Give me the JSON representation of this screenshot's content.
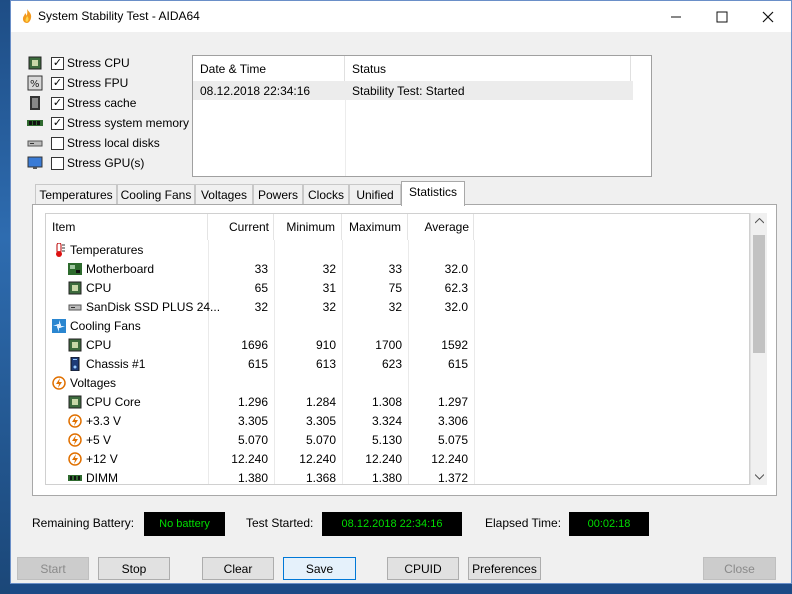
{
  "window": {
    "title": "System Stability Test - AIDA64"
  },
  "stress_options": [
    {
      "label": "Stress CPU",
      "checked": true,
      "icon": "cpu-chip-icon"
    },
    {
      "label": "Stress FPU",
      "checked": true,
      "icon": "fpu-percent-icon"
    },
    {
      "label": "Stress cache",
      "checked": true,
      "icon": "cache-chip-icon"
    },
    {
      "label": "Stress system memory",
      "checked": true,
      "icon": "memory-module-icon"
    },
    {
      "label": "Stress local disks",
      "checked": false,
      "icon": "disk-drive-icon"
    },
    {
      "label": "Stress GPU(s)",
      "checked": false,
      "icon": "monitor-icon"
    }
  ],
  "status_log": {
    "headers": [
      "Date & Time",
      "Status"
    ],
    "rows": [
      {
        "datetime": "08.12.2018 22:34:16",
        "status": "Stability Test: Started"
      }
    ]
  },
  "tabs": [
    "Temperatures",
    "Cooling Fans",
    "Voltages",
    "Powers",
    "Clocks",
    "Unified",
    "Statistics"
  ],
  "active_tab": "Statistics",
  "stats": {
    "headers": {
      "item": "Item",
      "current": "Current",
      "minimum": "Minimum",
      "maximum": "Maximum",
      "average": "Average"
    },
    "rows": [
      {
        "type": "group",
        "label": "Temperatures",
        "icon": "thermometer-icon"
      },
      {
        "type": "item",
        "label": "Motherboard",
        "icon": "motherboard-icon",
        "current": "33",
        "min": "32",
        "max": "33",
        "avg": "32.0"
      },
      {
        "type": "item",
        "label": "CPU",
        "icon": "cpu-chip-icon",
        "current": "65",
        "min": "31",
        "max": "75",
        "avg": "62.3"
      },
      {
        "type": "item",
        "label": "SanDisk SSD PLUS 24...",
        "icon": "disk-drive-icon",
        "current": "32",
        "min": "32",
        "max": "32",
        "avg": "32.0"
      },
      {
        "type": "group",
        "label": "Cooling Fans",
        "icon": "fan-icon"
      },
      {
        "type": "item",
        "label": "CPU",
        "icon": "cpu-chip-icon",
        "current": "1696",
        "min": "910",
        "max": "1700",
        "avg": "1592"
      },
      {
        "type": "item",
        "label": "Chassis #1",
        "icon": "chassis-icon",
        "current": "615",
        "min": "613",
        "max": "623",
        "avg": "615"
      },
      {
        "type": "group",
        "label": "Voltages",
        "icon": "voltage-icon"
      },
      {
        "type": "item",
        "label": "CPU Core",
        "icon": "cpu-chip-icon",
        "current": "1.296",
        "min": "1.284",
        "max": "1.308",
        "avg": "1.297"
      },
      {
        "type": "item",
        "label": "+3.3 V",
        "icon": "voltage-icon",
        "current": "3.305",
        "min": "3.305",
        "max": "3.324",
        "avg": "3.306"
      },
      {
        "type": "item",
        "label": "+5 V",
        "icon": "voltage-icon",
        "current": "5.070",
        "min": "5.070",
        "max": "5.130",
        "avg": "5.075"
      },
      {
        "type": "item",
        "label": "+12 V",
        "icon": "voltage-icon",
        "current": "12.240",
        "min": "12.240",
        "max": "12.240",
        "avg": "12.240"
      },
      {
        "type": "item",
        "label": "DIMM",
        "icon": "memory-module-icon",
        "current": "1.380",
        "min": "1.368",
        "max": "1.380",
        "avg": "1.372"
      }
    ]
  },
  "footer": {
    "battery_label": "Remaining Battery:",
    "battery_value": "No battery",
    "started_label": "Test Started:",
    "started_value": "08.12.2018 22:34:16",
    "elapsed_label": "Elapsed Time:",
    "elapsed_value": "00:02:18"
  },
  "buttons": {
    "start": "Start",
    "stop": "Stop",
    "clear": "Clear",
    "save": "Save",
    "cpuid": "CPUID",
    "preferences": "Preferences",
    "close": "Close"
  },
  "colors": {
    "lcd_background": "#000000",
    "lcd_text": "#00dd00",
    "accent": "#0078d7"
  }
}
